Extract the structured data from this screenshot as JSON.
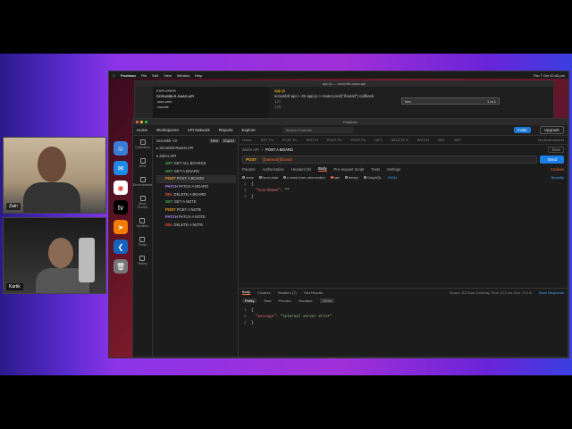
{
  "mac_menu": {
    "app": "Postman",
    "items": [
      "File",
      "Edit",
      "View",
      "Window",
      "Help"
    ],
    "clock": "Thu 7 Oct 10:40 pm"
  },
  "vscode": {
    "title": "app.js — scrumlib-saas-api",
    "explorer_label": "EXPLORER",
    "project": "SCRUMBLR-SAAS-API",
    "files": [
      ".aws-sam",
      ".vscode"
    ],
    "tab": "app.js",
    "crumb": "scrumblr-api > JS app.js > router.post(\"/board\") callback",
    "lines": [
      "127",
      "128"
    ],
    "find_text": "trim",
    "find_count": "1 of 1"
  },
  "postman": {
    "window_title": "Postman",
    "nav": [
      "Home",
      "Workspaces",
      "API Network",
      "Reports",
      "Explore"
    ],
    "search_placeholder": "Search Postman",
    "invite": "Invite",
    "upgrade": "Upgrade",
    "workspace_title": "Scrumblr V2",
    "new_btn": "New",
    "import_btn": "Import",
    "rail": [
      "Collections",
      "APIs",
      "Environments",
      "Mock Servers",
      "Monitors",
      "Flows",
      "History"
    ],
    "tree_roots": [
      "Scrumblr-Rarest API",
      "Zain's API"
    ],
    "requests": [
      {
        "method": "GET",
        "label": "GET ALL BOARDS"
      },
      {
        "method": "GET",
        "label": "GET A BOARD"
      },
      {
        "method": "POST",
        "label": "POST A BOARD"
      },
      {
        "method": "PATCH",
        "label": "PATCH A BOARD"
      },
      {
        "method": "DEL",
        "label": "DELETE A BOARD"
      },
      {
        "method": "GET",
        "label": "GET A NOTE"
      },
      {
        "method": "POST",
        "label": "POST A NOTE"
      },
      {
        "method": "PATCH",
        "label": "PATCH A NOTE"
      },
      {
        "method": "DEL",
        "label": "DELETE A NOTE"
      }
    ],
    "open_tabs": [
      "Overv",
      "GET Pu",
      "POST Pu",
      "PATCH",
      "POST Pu",
      "POST Pu",
      "GET",
      "DELETE A",
      "PATCH",
      "GET",
      "GET"
    ],
    "env": "No Environment",
    "breadcrumb_root": "Zain's API",
    "breadcrumb_leaf": "POST A BOARD",
    "save": "Save",
    "method": "POST",
    "url": "{{baseurl}}/board",
    "send": "Send",
    "req_tabs": [
      "Params",
      "Authorization",
      "Headers (9)",
      "Body",
      "Pre-request Script",
      "Tests",
      "Settings"
    ],
    "cookies": "Cookies",
    "body_types": [
      "none",
      "form-data",
      "x-www-form-urlencoded",
      "raw",
      "binary",
      "GraphQL"
    ],
    "body_format": "JSON",
    "beautify": "Beautify",
    "req_code": [
      {
        "ln": "1",
        "text": "{"
      },
      {
        "ln": "2",
        "key": "\"boardName\"",
        "text": ": \"\""
      },
      {
        "ln": "3",
        "text": "}"
      }
    ],
    "res_tabs": [
      "Body",
      "Cookies",
      "Headers (7)",
      "Test Results"
    ],
    "status": "Status: 502 Bad Gateway   Time: 374 ms   Size: 372 B",
    "save_response": "Save Response",
    "res_views": [
      "Pretty",
      "Raw",
      "Preview",
      "Visualize",
      "JSON"
    ],
    "res_code": [
      {
        "ln": "1",
        "text": "{"
      },
      {
        "ln": "2",
        "key": "\"message\"",
        "val": "\"Internal server error\""
      },
      {
        "ln": "3",
        "text": "}"
      }
    ]
  },
  "participants": [
    {
      "name": "Zain"
    },
    {
      "name": "Kartik"
    }
  ]
}
